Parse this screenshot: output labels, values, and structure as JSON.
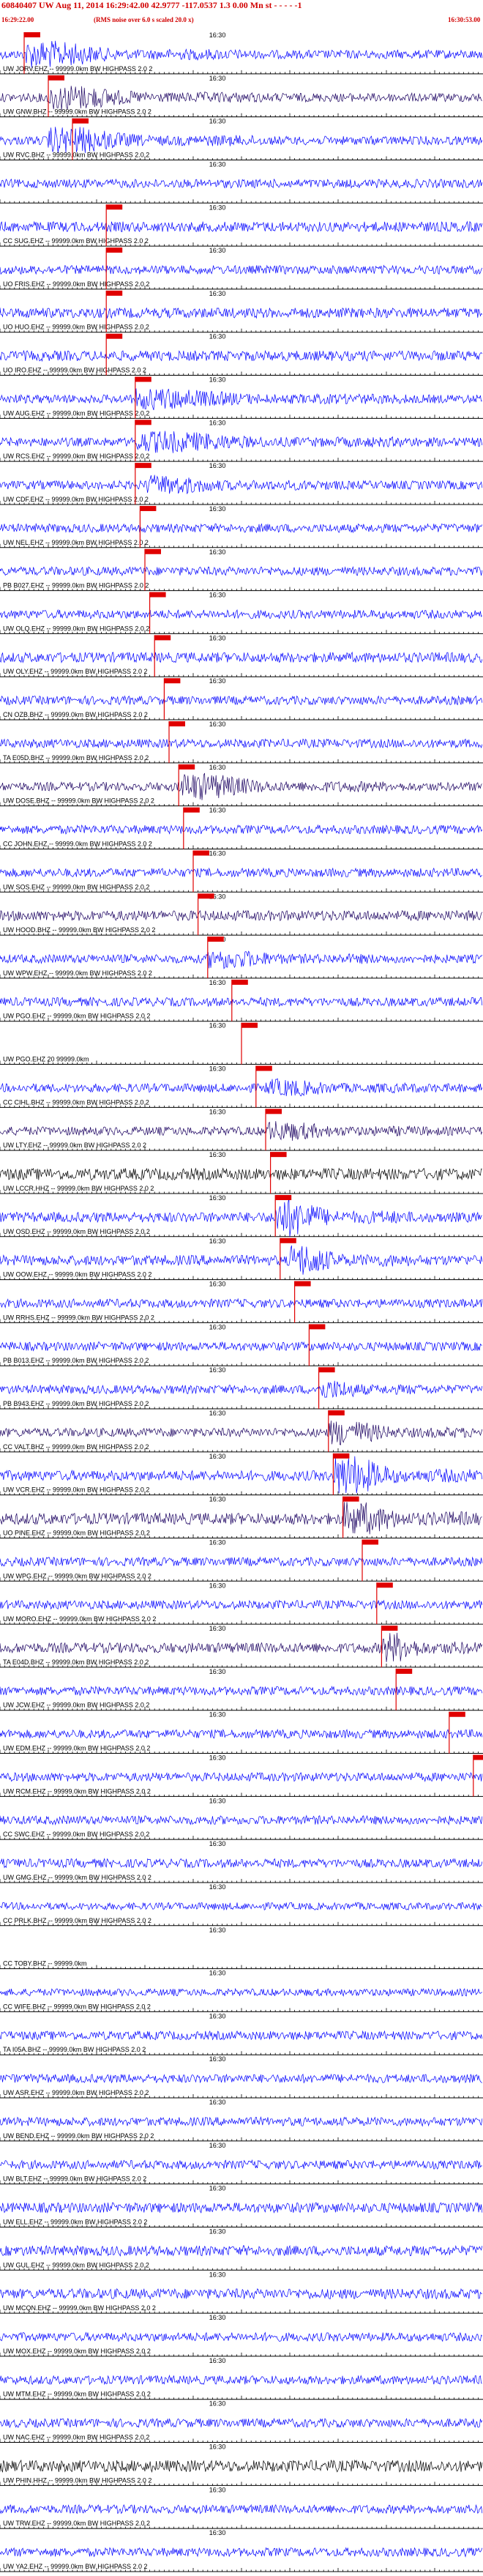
{
  "header": {
    "title": "60840407 UW Aug 11, 2014 16:29:42.00    42.9777  -117.0537  1.3 0.00 Mn st    - -  - -  -1",
    "start_time": "16:29:22.00",
    "note": "(RMS noise over 6.0 s scaled 20.0 x)",
    "end_time": "16:30:53.00"
  },
  "colors": {
    "blue": "#0000ff",
    "dark": "#1a0060",
    "black": "#000000",
    "red": "#e00000",
    "axis": "#000000"
  },
  "chart_data": {
    "type": "line",
    "title": "60840407 UW Aug 11, 2014 16:29:42.00",
    "x_range": [
      "16:29:22.00",
      "16:30:53.00"
    ],
    "tick_label": "16:30",
    "series": [
      {
        "label": "UW JORV.EHZ -- 99999.0km BW  HIGHPASS  2.0 2",
        "color": "blue",
        "amp": 6,
        "pick": 0.05,
        "burst": [
          0.05,
          0.5
        ],
        "burst_amp": 20
      },
      {
        "label": "UW GNW.BHZ -- 99999.0km BW  HIGHPASS  2.0 2",
        "color": "dark",
        "amp": 6,
        "pick": 0.1,
        "burst": [
          0.1,
          0.55
        ],
        "burst_amp": 18
      },
      {
        "label": "UW RVC.BHZ -- 99999.0km BW  HIGHPASS  2.0 2",
        "color": "blue",
        "amp": 6,
        "pick": 0.15,
        "burst": [
          0.1,
          0.55
        ],
        "burst_amp": 20
      },
      {
        "label": "",
        "color": "blue",
        "amp": 6
      },
      {
        "label": "CC SUG.EHZ -- 99999.0km BW  HIGHPASS  2.0 2",
        "color": "blue",
        "amp": 7,
        "pick": 0.22
      },
      {
        "label": "UO FRIS.EHZ -- 99999.0km BW  HIGHPASS  2.0 2",
        "color": "blue",
        "amp": 6,
        "pick": 0.22
      },
      {
        "label": "UO HUO.EHZ -- 99999.0km BW  HIGHPASS  2.0 2",
        "color": "blue",
        "amp": 7,
        "pick": 0.22
      },
      {
        "label": "UO IRO.EHZ -- 99999.0km BW  HIGHPASS  2.0 2",
        "color": "blue",
        "amp": 7,
        "pick": 0.22
      },
      {
        "label": "UW AUG.EHZ -- 99999.0km BW  HIGHPASS  2.0 2",
        "color": "blue",
        "amp": 6,
        "pick": 0.28,
        "burst": [
          0.28,
          0.85
        ],
        "burst_amp": 14
      },
      {
        "label": "UW RCS.EHZ -- 99999.0km BW  HIGHPASS  2.0 2",
        "color": "blue",
        "amp": 6,
        "pick": 0.28,
        "burst": [
          0.28,
          0.9
        ],
        "burst_amp": 14
      },
      {
        "label": "UW CDF.EHZ -- 99999.0km BW  HIGHPASS  2.0 2",
        "color": "blue",
        "amp": 6,
        "pick": 0.28,
        "burst": [
          0.3,
          0.7
        ],
        "burst_amp": 12
      },
      {
        "label": "UW NEL.EHZ -- 99999.0km BW  HIGHPASS  2.0 2",
        "color": "blue",
        "amp": 6,
        "pick": 0.29
      },
      {
        "label": "PB B027.EHZ -- 99999.0km BW  HIGHPASS  2.0 2",
        "color": "blue",
        "amp": 6,
        "pick": 0.3
      },
      {
        "label": "UW OLQ.EHZ -- 99999.0km BW  HIGHPASS  2.0 2",
        "color": "blue",
        "amp": 6,
        "pick": 0.31
      },
      {
        "label": "UW OLY.EHZ -- 99999.0km BW  HIGHPASS  2.0 2",
        "color": "blue",
        "amp": 7,
        "pick": 0.32
      },
      {
        "label": "CN OZB.BHZ -- 99999.0km BW  HIGHPASS  2.0 2",
        "color": "blue",
        "amp": 6,
        "pick": 0.34
      },
      {
        "label": "TA E05D.BHZ -- 99999.0km BW  HIGHPASS  2.0 2",
        "color": "blue",
        "amp": 6,
        "pick": 0.35
      },
      {
        "label": "UW DOSE.BHZ -- 99999.0km BW  HIGHPASS  2.0 2",
        "color": "dark",
        "amp": 6,
        "pick": 0.37,
        "burst": [
          0.37,
          0.8
        ],
        "burst_amp": 20
      },
      {
        "label": "CC JOHN.EHZ -- 99999.0km BW  HIGHPASS  2.0 2",
        "color": "blue",
        "amp": 6,
        "pick": 0.38
      },
      {
        "label": "UW SOS.EHZ -- 99999.0km BW  HIGHPASS  2.0 2",
        "color": "blue",
        "amp": 6,
        "pick": 0.4
      },
      {
        "label": "UW HOOD.BHZ -- 99999.0km BW  HIGHPASS  2.0 2",
        "color": "dark",
        "amp": 7,
        "pick": 0.41
      },
      {
        "label": "UW WPW.EHZ -- 99999.0km BW  HIGHPASS  2.0 2",
        "color": "blue",
        "amp": 6,
        "pick": 0.43,
        "burst": [
          0.43,
          0.8
        ],
        "burst_amp": 12
      },
      {
        "label": "UW PGO.EHZ -- 99999.0km BW  HIGHPASS  2.0 2",
        "color": "blue",
        "amp": 6,
        "pick": 0.48
      },
      {
        "label": "UW PGO.EHZ 20 99999.0km",
        "color": "blue",
        "amp": 0,
        "pick": 0.5
      },
      {
        "label": "CC CIHL.BHZ -- 99999.0km BW  HIGHPASS  2.0 2",
        "color": "blue",
        "amp": 6,
        "pick": 0.53,
        "burst": [
          0.55,
          0.9
        ],
        "burst_amp": 10
      },
      {
        "label": "UW LTY.EHZ -- 99999.0km BW  HIGHPASS  2.0 2",
        "color": "dark",
        "amp": 6,
        "pick": 0.55,
        "burst": [
          0.55,
          0.9
        ],
        "burst_amp": 12
      },
      {
        "label": "UW LCCR.HHZ -- 99999.0km BW  HIGHPASS  2.0 2",
        "color": "black",
        "amp": 8,
        "pick": 0.56
      },
      {
        "label": "UW OSD.EHZ -- 99999.0km BW  HIGHPASS  2.0 2",
        "color": "blue",
        "amp": 7,
        "pick": 0.57,
        "burst": [
          0.57,
          0.85
        ],
        "burst_amp": 30
      },
      {
        "label": "UW OOW.EHZ -- 99999.0km BW  HIGHPASS  2.0 2",
        "color": "blue",
        "amp": 7,
        "pick": 0.58,
        "burst": [
          0.6,
          0.85
        ],
        "burst_amp": 24
      },
      {
        "label": "UW RRHS.EHZ -- 99999.0km BW  HIGHPASS  2.0 2",
        "color": "blue",
        "amp": 6,
        "pick": 0.61
      },
      {
        "label": "PB B013.EHZ -- 99999.0km BW  HIGHPASS  2.0 2",
        "color": "blue",
        "amp": 6,
        "pick": 0.64
      },
      {
        "label": "PB B943.EHZ -- 99999.0km BW  HIGHPASS  2.0 2",
        "color": "blue",
        "amp": 6,
        "pick": 0.66,
        "burst": [
          0.66,
          0.9
        ],
        "burst_amp": 12
      },
      {
        "label": "CC VALT.BHZ -- 99999.0km BW  HIGHPASS  2.0 2",
        "color": "dark",
        "amp": 6,
        "pick": 0.68,
        "burst": [
          0.68,
          1.0
        ],
        "burst_amp": 18
      },
      {
        "label": "UW VCR.EHZ -- 99999.0km BW  HIGHPASS  2.0 2",
        "color": "blue",
        "amp": 7,
        "pick": 0.69,
        "burst": [
          0.69,
          1.0
        ],
        "burst_amp": 32
      },
      {
        "label": "UO PINE.EHZ -- 99999.0km BW  HIGHPASS  2.0 2",
        "color": "dark",
        "amp": 8,
        "pick": 0.71,
        "burst": [
          0.71,
          1.0
        ],
        "burst_amp": 24
      },
      {
        "label": "UW WPG.EHZ -- 99999.0km BW  HIGHPASS  2.0 2",
        "color": "blue",
        "amp": 6,
        "pick": 0.75
      },
      {
        "label": "UW MORO.EHZ -- 99999.0km BW  HIGHPASS  2.0 2",
        "color": "blue",
        "amp": 6,
        "pick": 0.78
      },
      {
        "label": "TA E04D.BHZ -- 99999.0km BW  HIGHPASS  2.0 2",
        "color": "dark",
        "amp": 7,
        "pick": 0.79,
        "burst": [
          0.79,
          1.0
        ],
        "burst_amp": 22
      },
      {
        "label": "UW JCW.EHZ -- 99999.0km BW  HIGHPASS  2.0 2",
        "color": "blue",
        "amp": 6,
        "pick": 0.82
      },
      {
        "label": "UW EDM.EHZ -- 99999.0km BW  HIGHPASS  2.0 2",
        "color": "blue",
        "amp": 6,
        "pick": 0.93
      },
      {
        "label": "UW RCM.EHZ -- 99999.0km BW  HIGHPASS  2.0 2",
        "color": "blue",
        "amp": 6,
        "pick": 0.98
      },
      {
        "label": "CC SWC.EHZ -- 99999.0km BW  HIGHPASS  2.0 2",
        "color": "blue",
        "amp": 6
      },
      {
        "label": "UW GMG.EHZ -- 99999.0km BW  HIGHPASS  2.0 2",
        "color": "blue",
        "amp": 6
      },
      {
        "label": "CC PRLK.BHZ -- 99999.0km BW  HIGHPASS  2.0 2",
        "color": "blue",
        "amp": 5
      },
      {
        "label": "CC TOBY.BHZ -- 99999.0km",
        "color": "blue",
        "amp": 0
      },
      {
        "label": "CC WIFE.BHZ -- 99999.0km BW  HIGHPASS  2.0 2",
        "color": "blue",
        "amp": 5
      },
      {
        "label": "TA I05A.BHZ -- 99999.0km BW  HIGHPASS  2.0 2",
        "color": "blue",
        "amp": 6
      },
      {
        "label": "UW ASR.EHZ -- 99999.0km BW  HIGHPASS  2.0 2",
        "color": "blue",
        "amp": 6
      },
      {
        "label": "UW BEND.EHZ -- 99999.0km BW  HIGHPASS  2.0 2",
        "color": "blue",
        "amp": 6
      },
      {
        "label": "UW BLT.EHZ -- 99999.0km BW  HIGHPASS  2.0 2",
        "color": "blue",
        "amp": 6
      },
      {
        "label": "UW ELL.EHZ -- 99999.0km BW  HIGHPASS  2.0 2",
        "color": "blue",
        "amp": 7
      },
      {
        "label": "UW GUL.EHZ -- 99999.0km BW  HIGHPASS  2.0 2",
        "color": "blue",
        "amp": 7
      },
      {
        "label": "UW MCQN.EHZ -- 99999.0km BW  HIGHPASS  2.0 2",
        "color": "blue",
        "amp": 7
      },
      {
        "label": "UW MOX.EHZ -- 99999.0km BW  HIGHPASS  2.0 2",
        "color": "blue",
        "amp": 6
      },
      {
        "label": "UW MTM.EHZ -- 99999.0km BW  HIGHPASS  2.0 2",
        "color": "blue",
        "amp": 6
      },
      {
        "label": "UW NAC.EHZ -- 99999.0km BW  HIGHPASS  2.0 2",
        "color": "blue",
        "amp": 6
      },
      {
        "label": "UW PHIN.HHZ -- 99999.0km BW  HIGHPASS  2.0 2",
        "color": "black",
        "amp": 8
      },
      {
        "label": "UW TRW.EHZ -- 99999.0km BW  HIGHPASS  2.0 2",
        "color": "blue",
        "amp": 6
      },
      {
        "label": "UW YA2.EHZ -- 99999.0km BW  HIGHPASS  2.0 2",
        "color": "blue",
        "amp": 6
      }
    ]
  }
}
